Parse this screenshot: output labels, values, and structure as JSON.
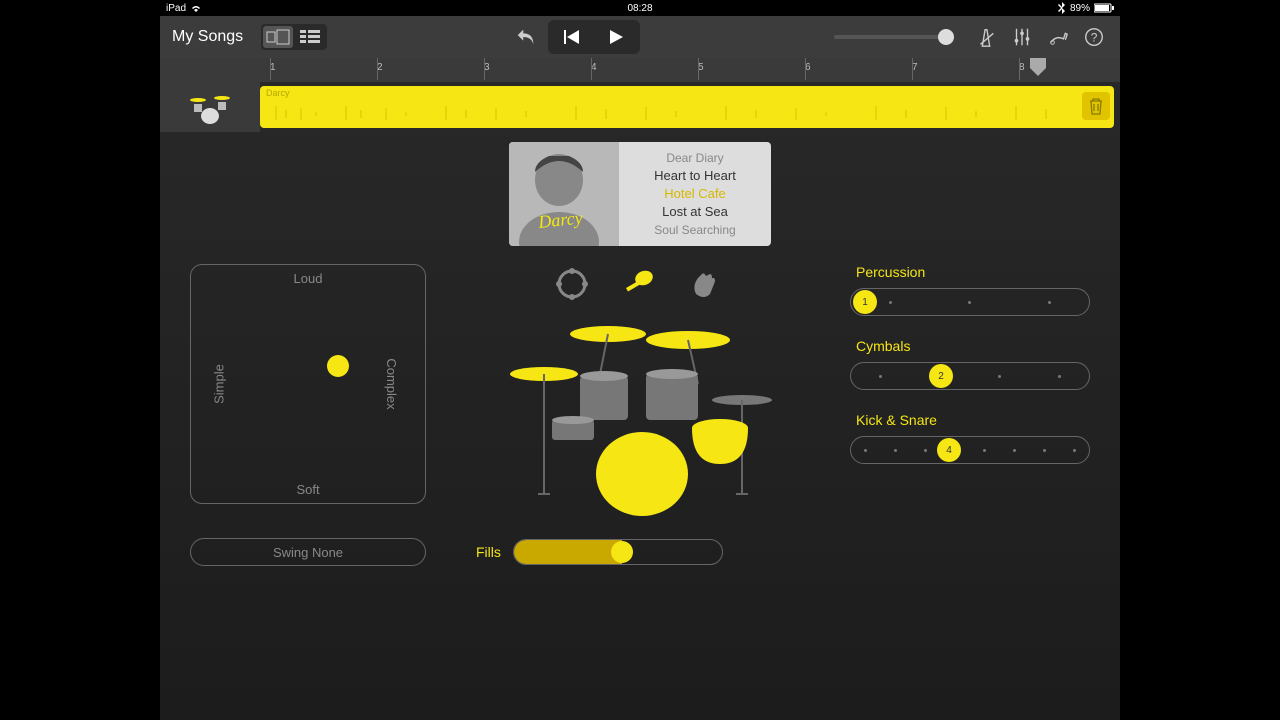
{
  "status": {
    "device": "iPad",
    "time": "08:28",
    "battery": "89%"
  },
  "toolbar": {
    "back_label": "My Songs"
  },
  "ruler": {
    "marks": [
      "1",
      "2",
      "3",
      "4",
      "5",
      "6",
      "7",
      "8"
    ]
  },
  "track": {
    "region_name": "Darcy"
  },
  "preset": {
    "drummer_name": "Darcy",
    "items": [
      "Dear Diary",
      "Heart to Heart",
      "Hotel Cafe",
      "Lost at Sea",
      "Soul Searching"
    ],
    "selected": "Hotel Cafe"
  },
  "xy": {
    "top": "Loud",
    "bottom": "Soft",
    "left": "Simple",
    "right": "Complex"
  },
  "sliders": {
    "percussion": {
      "label": "Percussion",
      "value": "1",
      "dots": 3,
      "pos": 4
    },
    "cymbals": {
      "label": "Cymbals",
      "value": "2",
      "dots": 4,
      "pos": 35
    },
    "kicksnare": {
      "label": "Kick & Snare",
      "value": "4",
      "dots": 8,
      "pos": 38
    }
  },
  "swing": {
    "label": "Swing None"
  },
  "fills": {
    "label": "Fills",
    "pct": 52
  }
}
